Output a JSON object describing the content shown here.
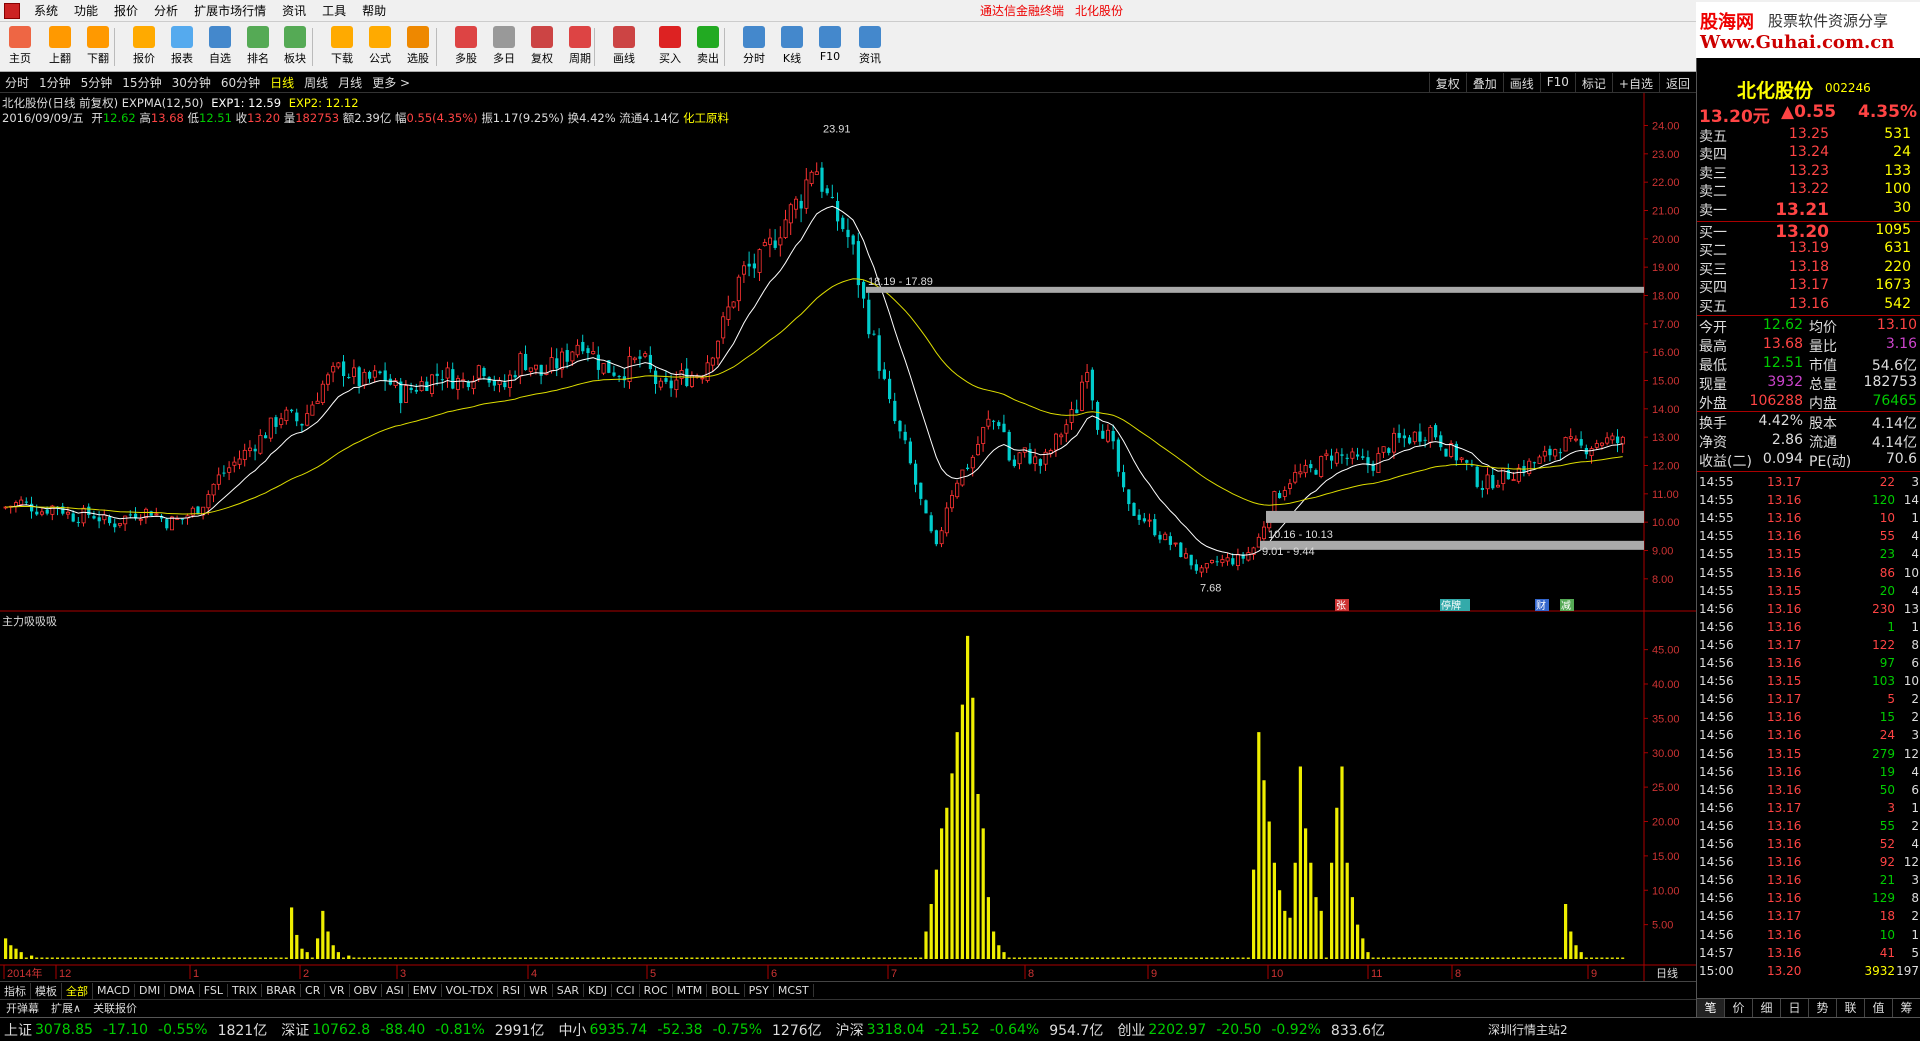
{
  "menu": {
    "items": [
      "系统",
      "功能",
      "报价",
      "分析",
      "扩展市场行情",
      "资讯",
      "工具",
      "帮助"
    ],
    "brand": "通达信金融终端",
    "brand_stock": "北化股份"
  },
  "logo": {
    "line1a": "股海网",
    "line1b": "股票软件资源分享",
    "line2": "Www.Guhai.com.cn"
  },
  "toolbar": {
    "buttons": [
      {
        "label": "主页",
        "icon": "home-icon",
        "color": "#e64"
      },
      {
        "label": "上翻",
        "icon": "arrow-up-icon",
        "color": "#f90"
      },
      {
        "label": "下翻",
        "icon": "arrow-down-icon",
        "color": "#f90"
      },
      {
        "label": "报价",
        "icon": "quote-icon",
        "color": "#fa0"
      },
      {
        "label": "报表",
        "icon": "report-icon",
        "color": "#5ae"
      },
      {
        "label": "自选",
        "icon": "favorites-icon",
        "color": "#48c"
      },
      {
        "label": "排名",
        "icon": "rank-icon",
        "color": "#5a5"
      },
      {
        "label": "板块",
        "icon": "sector-icon",
        "color": "#5a5"
      },
      {
        "label": "下载",
        "icon": "download-icon",
        "color": "#fa0"
      },
      {
        "label": "公式",
        "icon": "formula-icon",
        "color": "#fa0"
      },
      {
        "label": "选股",
        "icon": "stock-picker-icon",
        "color": "#e80"
      },
      {
        "label": "多股",
        "icon": "multi-stock-icon",
        "color": "#d44"
      },
      {
        "label": "多日",
        "icon": "multi-day-icon",
        "color": "#999"
      },
      {
        "label": "复权",
        "icon": "adjust-icon",
        "color": "#c44"
      },
      {
        "label": "周期",
        "icon": "period-icon",
        "color": "#d44"
      },
      {
        "label": "画线",
        "icon": "draw-line-icon",
        "color": "#c44"
      },
      {
        "label": "买入",
        "icon": "buy-icon",
        "color": "#d22"
      },
      {
        "label": "卖出",
        "icon": "sell-icon",
        "color": "#2a2"
      },
      {
        "label": "分时",
        "icon": "intraday-icon",
        "color": "#48c"
      },
      {
        "label": "K线",
        "icon": "kline-icon",
        "color": "#48c"
      },
      {
        "label": "F10",
        "icon": "f10-icon",
        "color": "#48c"
      },
      {
        "label": "资讯",
        "icon": "news-icon",
        "color": "#48c"
      }
    ]
  },
  "periods": {
    "items": [
      "分时",
      "1分钟",
      "5分钟",
      "15分钟",
      "30分钟",
      "60分钟",
      "日线",
      "周线",
      "月线",
      "更多 >"
    ],
    "active": "日线"
  },
  "chart_tools": [
    "复权",
    "叠加",
    "画线",
    "F10",
    "标记",
    "+自选",
    "返回"
  ],
  "info": {
    "title": "北化股份(日线 前复权) EXPMA(12,50)",
    "exp1": "EXP1: 12.59",
    "exp2": "EXP2: 12.12",
    "date": "2016/09/09/五",
    "open_lbl": "开",
    "open": "12.62",
    "high_lbl": "高",
    "high": "13.68",
    "low_lbl": "低",
    "low": "12.51",
    "close_lbl": "收",
    "close": "13.20",
    "vol_lbl": "量",
    "vol": "182753",
    "amount": "额2.39亿",
    "chg_lbl": "幅",
    "chg": "0.55(4.35%)",
    "amp": "振1.17(9.25%)",
    "turnover": "换4.42%",
    "float": "流通4.14亿",
    "industry": "化工原料"
  },
  "chart_data": {
    "type": "candlestick",
    "ohlc_series": "daily_kline",
    "overlays": [
      "EXP1",
      "EXP2"
    ],
    "y_ticks": [
      "24.00",
      "23.00",
      "22.00",
      "21.00",
      "20.00",
      "19.00",
      "18.00",
      "17.00",
      "16.00",
      "15.00",
      "14.00",
      "13.00",
      "12.00",
      "11.00",
      "10.00",
      "9.00",
      "8.00"
    ],
    "annotations": {
      "high_label": "23.91",
      "low_label": "7.68",
      "band1": "18.19 - 17.89",
      "band2": "10.16 - 10.13",
      "band3": "9.01 - 9.44"
    },
    "event_markers": [
      "张",
      "停牌",
      "财",
      "减"
    ],
    "x_labels": [
      "2014年",
      "12",
      "1",
      "2",
      "3",
      "4",
      "5",
      "6",
      "7",
      "8",
      "9",
      "10",
      "11",
      "8",
      "9"
    ],
    "indicator": {
      "name": "主力吸吸吸",
      "y_ticks": [
        "45.00",
        "40.00",
        "35.00",
        "30.00",
        "25.00",
        "20.00",
        "15.00",
        "10.00",
        "5.00"
      ],
      "bars": [
        [
          0,
          3
        ],
        [
          1,
          2
        ],
        [
          2,
          1.5
        ],
        [
          3,
          1
        ],
        [
          5,
          0.5
        ],
        [
          55,
          7.5
        ],
        [
          56,
          3.5
        ],
        [
          57,
          1.5
        ],
        [
          58,
          1
        ],
        [
          60,
          3
        ],
        [
          61,
          7
        ],
        [
          62,
          4
        ],
        [
          63,
          2
        ],
        [
          64,
          1
        ],
        [
          66,
          0.5
        ],
        [
          177,
          4
        ],
        [
          178,
          8
        ],
        [
          179,
          13
        ],
        [
          180,
          19
        ],
        [
          181,
          22
        ],
        [
          182,
          27
        ],
        [
          183,
          33
        ],
        [
          184,
          37
        ],
        [
          185,
          47
        ],
        [
          186,
          38
        ],
        [
          187,
          24
        ],
        [
          188,
          19
        ],
        [
          189,
          9
        ],
        [
          190,
          4
        ],
        [
          191,
          2
        ],
        [
          192,
          1
        ],
        [
          240,
          13
        ],
        [
          241,
          33
        ],
        [
          242,
          26
        ],
        [
          243,
          20
        ],
        [
          244,
          14
        ],
        [
          245,
          10
        ],
        [
          246,
          7
        ],
        [
          247,
          6
        ],
        [
          248,
          14
        ],
        [
          249,
          28
        ],
        [
          250,
          19
        ],
        [
          251,
          14
        ],
        [
          252,
          9
        ],
        [
          253,
          7
        ],
        [
          255,
          14
        ],
        [
          256,
          22
        ],
        [
          257,
          28
        ],
        [
          258,
          14
        ],
        [
          259,
          9
        ],
        [
          260,
          5
        ],
        [
          261,
          3
        ],
        [
          262,
          1
        ],
        [
          300,
          8
        ],
        [
          301,
          4
        ],
        [
          302,
          2
        ],
        [
          303,
          1
        ]
      ]
    }
  },
  "bottom_tabs": {
    "items": [
      "指标",
      "模板",
      "全部",
      "MACD",
      "DMI",
      "DMA",
      "FSL",
      "TRIX",
      "BRAR",
      "CR",
      "VR",
      "OBV",
      "ASI",
      "EMV",
      "VOL-TDX",
      "RSI",
      "WR",
      "SAR",
      "KDJ",
      "CCI",
      "ROC",
      "MTM",
      "BOLL",
      "PSY",
      "MCST"
    ],
    "active": "全部",
    "period": "日线"
  },
  "funcbar": [
    "开弹幕",
    "扩展∧",
    "关联报价"
  ],
  "stock": {
    "name": "北化股份",
    "code": "002246",
    "price": "13.20元",
    "change": "▲0.55",
    "pct": "4.35%"
  },
  "orderbook": {
    "asks": [
      {
        "label": "卖五",
        "price": "13.25",
        "vol": "531"
      },
      {
        "label": "卖四",
        "price": "13.24",
        "vol": "24"
      },
      {
        "label": "卖三",
        "price": "13.23",
        "vol": "133"
      },
      {
        "label": "卖二",
        "price": "13.22",
        "vol": "100"
      },
      {
        "label": "卖一",
        "price": "13.21",
        "vol": "30"
      }
    ],
    "bids": [
      {
        "label": "买一",
        "price": "13.20",
        "vol": "1095"
      },
      {
        "label": "买二",
        "price": "13.19",
        "vol": "631"
      },
      {
        "label": "买三",
        "price": "13.18",
        "vol": "220"
      },
      {
        "label": "买四",
        "price": "13.17",
        "vol": "1673"
      },
      {
        "label": "买五",
        "price": "13.16",
        "vol": "542"
      }
    ]
  },
  "stats": [
    {
      "l1": "今开",
      "v1": "12.62",
      "c1": "#0c0",
      "l2": "均价",
      "v2": "13.10",
      "c2": "#f44"
    },
    {
      "l1": "最高",
      "v1": "13.68",
      "c1": "#f44",
      "l2": "量比",
      "v2": "3.16",
      "c2": "#c4c"
    },
    {
      "l1": "最低",
      "v1": "12.51",
      "c1": "#0c0",
      "l2": "市值",
      "v2": "54.6亿",
      "c2": "#ddd"
    },
    {
      "l1": "现量",
      "v1": "3932",
      "c1": "#c4c",
      "l2": "总量",
      "v2": "182753",
      "c2": "#ddd"
    },
    {
      "l1": "外盘",
      "v1": "106288",
      "c1": "#f44",
      "l2": "内盘",
      "v2": "76465",
      "c2": "#0c0"
    },
    {
      "l1": "换手",
      "v1": "4.42%",
      "c1": "#ddd",
      "l2": "股本",
      "v2": "4.14亿",
      "c2": "#ddd"
    },
    {
      "l1": "净资",
      "v1": "2.86",
      "c1": "#ddd",
      "l2": "流通",
      "v2": "4.14亿",
      "c2": "#ddd"
    },
    {
      "l1": "收益(二)",
      "v1": "0.094",
      "c1": "#ddd",
      "l2": "PE(动)",
      "v2": "70.6",
      "c2": "#ddd"
    }
  ],
  "ticks": [
    {
      "t": "14:55",
      "p": "13.17",
      "v": "22",
      "n": "3",
      "pc": "#f44",
      "vc": "#f44"
    },
    {
      "t": "14:55",
      "p": "13.16",
      "v": "120",
      "n": "14",
      "pc": "#f44",
      "vc": "#0c0"
    },
    {
      "t": "14:55",
      "p": "13.16",
      "v": "10",
      "n": "1",
      "pc": "#f44",
      "vc": "#f44"
    },
    {
      "t": "14:55",
      "p": "13.16",
      "v": "55",
      "n": "4",
      "pc": "#f44",
      "vc": "#f44"
    },
    {
      "t": "14:55",
      "p": "13.15",
      "v": "23",
      "n": "4",
      "pc": "#f44",
      "vc": "#0c0"
    },
    {
      "t": "14:55",
      "p": "13.16",
      "v": "86",
      "n": "10",
      "pc": "#f44",
      "vc": "#f44"
    },
    {
      "t": "14:55",
      "p": "13.15",
      "v": "20",
      "n": "4",
      "pc": "#f44",
      "vc": "#0c0"
    },
    {
      "t": "14:56",
      "p": "13.16",
      "v": "230",
      "n": "13",
      "pc": "#f44",
      "vc": "#f44"
    },
    {
      "t": "14:56",
      "p": "13.16",
      "v": "1",
      "n": "1",
      "pc": "#f44",
      "vc": "#0c0"
    },
    {
      "t": "14:56",
      "p": "13.17",
      "v": "122",
      "n": "8",
      "pc": "#f44",
      "vc": "#f44"
    },
    {
      "t": "14:56",
      "p": "13.16",
      "v": "97",
      "n": "6",
      "pc": "#f44",
      "vc": "#0c0"
    },
    {
      "t": "14:56",
      "p": "13.15",
      "v": "103",
      "n": "10",
      "pc": "#f44",
      "vc": "#0c0"
    },
    {
      "t": "14:56",
      "p": "13.17",
      "v": "5",
      "n": "2",
      "pc": "#f44",
      "vc": "#f44"
    },
    {
      "t": "14:56",
      "p": "13.16",
      "v": "15",
      "n": "2",
      "pc": "#f44",
      "vc": "#0c0"
    },
    {
      "t": "14:56",
      "p": "13.16",
      "v": "24",
      "n": "3",
      "pc": "#f44",
      "vc": "#f44"
    },
    {
      "t": "14:56",
      "p": "13.15",
      "v": "279",
      "n": "12",
      "pc": "#f44",
      "vc": "#0c0"
    },
    {
      "t": "14:56",
      "p": "13.16",
      "v": "19",
      "n": "4",
      "pc": "#f44",
      "vc": "#0c0"
    },
    {
      "t": "14:56",
      "p": "13.16",
      "v": "50",
      "n": "6",
      "pc": "#f44",
      "vc": "#0c0"
    },
    {
      "t": "14:56",
      "p": "13.17",
      "v": "3",
      "n": "1",
      "pc": "#f44",
      "vc": "#f44"
    },
    {
      "t": "14:56",
      "p": "13.16",
      "v": "55",
      "n": "2",
      "pc": "#f44",
      "vc": "#0c0"
    },
    {
      "t": "14:56",
      "p": "13.16",
      "v": "52",
      "n": "4",
      "pc": "#f44",
      "vc": "#f44"
    },
    {
      "t": "14:56",
      "p": "13.16",
      "v": "92",
      "n": "12",
      "pc": "#f44",
      "vc": "#f44"
    },
    {
      "t": "14:56",
      "p": "13.16",
      "v": "21",
      "n": "3",
      "pc": "#f44",
      "vc": "#0c0"
    },
    {
      "t": "14:56",
      "p": "13.16",
      "v": "129",
      "n": "8",
      "pc": "#f44",
      "vc": "#0c0"
    },
    {
      "t": "14:56",
      "p": "13.17",
      "v": "18",
      "n": "2",
      "pc": "#f44",
      "vc": "#f44"
    },
    {
      "t": "14:56",
      "p": "13.16",
      "v": "10",
      "n": "1",
      "pc": "#f44",
      "vc": "#0c0"
    },
    {
      "t": "14:57",
      "p": "13.16",
      "v": "41",
      "n": "5",
      "pc": "#f44",
      "vc": "#f44"
    },
    {
      "t": "15:00",
      "p": "13.20",
      "v": "3932",
      "n": "197",
      "pc": "#f44",
      "vc": "#ff0"
    }
  ],
  "rp_tabs": [
    "笔",
    "价",
    "细",
    "日",
    "势",
    "联",
    "值",
    "筹"
  ],
  "statusbar": [
    {
      "name": "上证",
      "val": "3078.85",
      "chg": "-17.10",
      "pct": "-0.55%",
      "amt": "1821亿"
    },
    {
      "name": "深证",
      "val": "10762.8",
      "chg": "-88.40",
      "pct": "-0.81%",
      "amt": "2991亿"
    },
    {
      "name": "中小",
      "val": "6935.74",
      "chg": "-52.38",
      "pct": "-0.75%",
      "amt": "1276亿"
    },
    {
      "name": "沪深",
      "val": "3318.04",
      "chg": "-21.52",
      "pct": "-0.64%",
      "amt": "954.7亿"
    },
    {
      "name": "创业",
      "val": "2202.97",
      "chg": "-20.50",
      "pct": "-0.92%",
      "amt": "833.6亿"
    }
  ],
  "site": "深圳行情主站2"
}
